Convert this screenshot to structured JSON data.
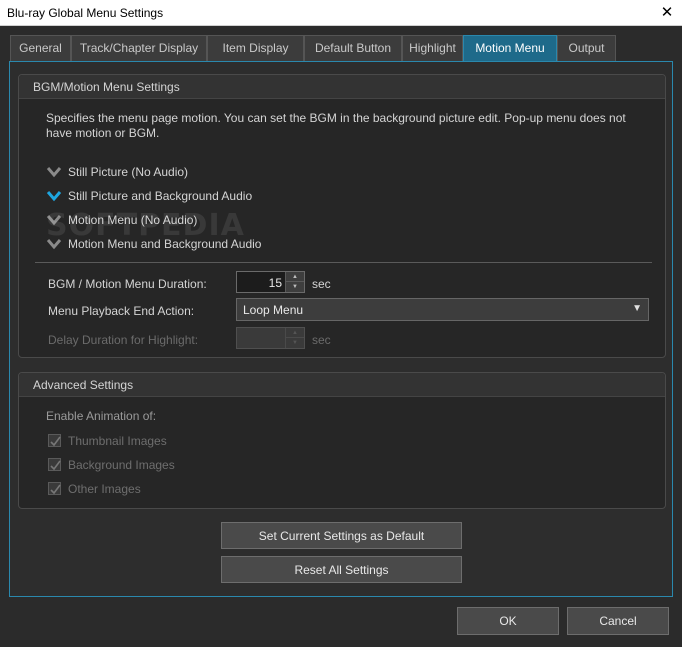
{
  "window": {
    "title": "Blu-ray Global Menu Settings"
  },
  "icons": {
    "close": "close-icon",
    "radio": "chevron-down-icon",
    "check": "checkmark-icon"
  },
  "colors": {
    "accent": "#1e6a8a",
    "radio_selected": "#1ea6e0",
    "radio_unselected": "#8a8a8a"
  },
  "tabs": [
    {
      "label": "General",
      "active": false
    },
    {
      "label": "Track/Chapter Display",
      "active": false
    },
    {
      "label": "Item Display",
      "active": false
    },
    {
      "label": "Default Button",
      "active": false
    },
    {
      "label": "Highlight",
      "active": false
    },
    {
      "label": "Motion Menu",
      "active": true
    },
    {
      "label": "Output",
      "active": false
    }
  ],
  "bgm_group": {
    "title": "BGM/Motion Menu Settings",
    "description": "Specifies the menu page motion. You can set the BGM in the background picture edit. Pop-up menu does not have motion or BGM.",
    "options": [
      {
        "label": "Still Picture (No Audio)",
        "selected": false
      },
      {
        "label": "Still Picture and Background Audio",
        "selected": true
      },
      {
        "label": "Motion Menu (No Audio)",
        "selected": false
      },
      {
        "label": "Motion Menu and Background Audio",
        "selected": false
      }
    ],
    "duration": {
      "label": "BGM / Motion Menu Duration:",
      "value": "15",
      "unit": "sec"
    },
    "end_action": {
      "label": "Menu Playback End Action:",
      "value": "Loop Menu"
    },
    "delay": {
      "label": "Delay Duration for Highlight:",
      "value": "",
      "unit": "sec",
      "enabled": false
    }
  },
  "advanced_group": {
    "title": "Advanced Settings",
    "enable_label": "Enable Animation of:",
    "checks": [
      {
        "label": "Thumbnail Images",
        "checked": true
      },
      {
        "label": "Background Images",
        "checked": true
      },
      {
        "label": "Other Images",
        "checked": true
      }
    ]
  },
  "buttons": {
    "set_default": "Set Current Settings as Default",
    "reset": "Reset All Settings",
    "ok": "OK",
    "cancel": "Cancel"
  },
  "watermark": "SOFTPEDIA"
}
